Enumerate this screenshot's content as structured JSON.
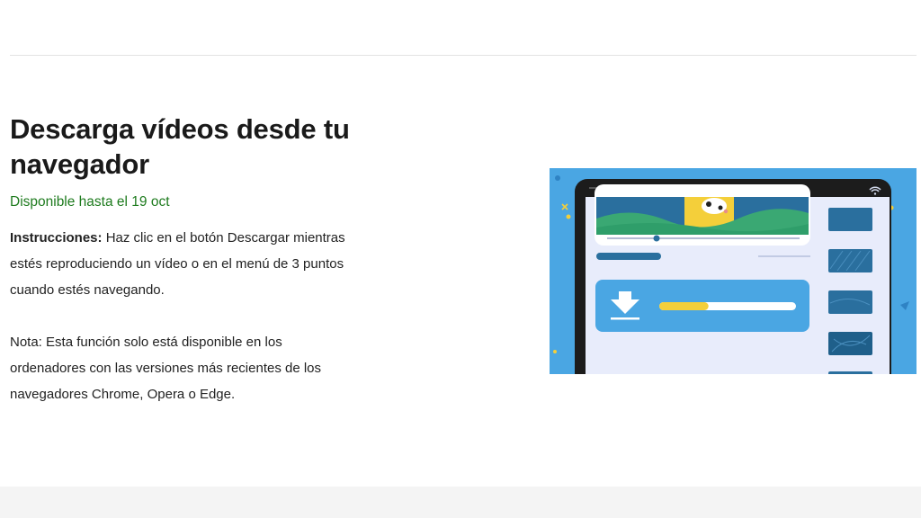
{
  "page": {
    "title": "Descarga vídeos desde tu navegador",
    "availability": "Disponible hasta el 19 oct",
    "instructions": {
      "label": "Instrucciones:",
      "text": " Haz clic en el botón Descargar mientras estés reproduciendo un vídeo o en el menú de 3 puntos cuando estés navegando."
    },
    "note": "Nota: Esta función solo está disponible en los ordenadores con las versiones más recientes de los navegadores Chrome, Opera o Edge."
  },
  "illustration": {
    "download_progress": 0.36,
    "colors": {
      "background": "#4aa6e3",
      "device": "#1c1c1c",
      "screen": "#e8ecfb",
      "accent_yellow": "#f4cf3a",
      "accent_green": "#3aa873",
      "thumb_blue": "#2a6f9e"
    }
  }
}
